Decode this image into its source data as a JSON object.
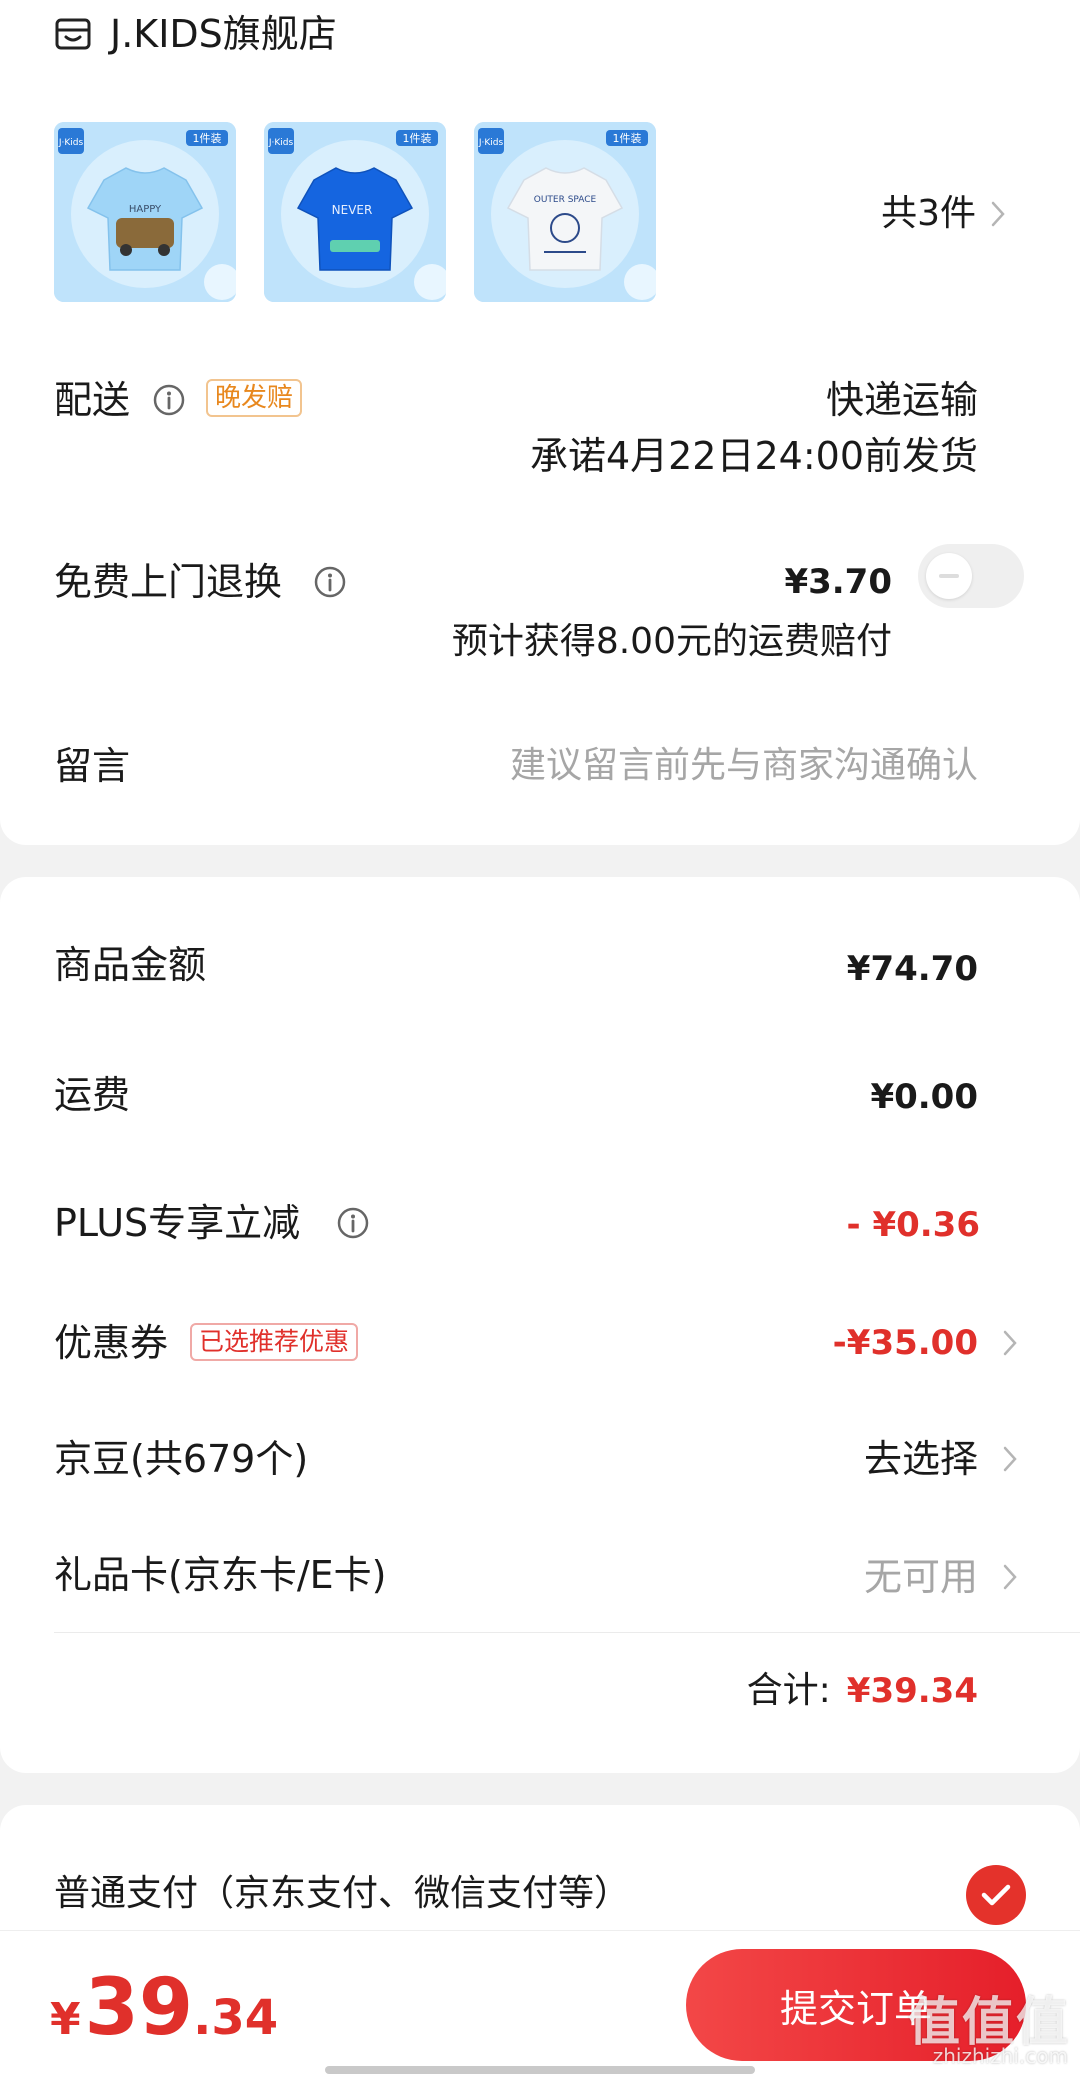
{
  "store": {
    "name": "J.KIDS旗舰店",
    "icon": "store-icon"
  },
  "products": {
    "thumbs": [
      {
        "badge": "1件装",
        "brand": "J·Kids",
        "shirt_color": "#9fd5f7",
        "print_text": "HAPPY"
      },
      {
        "badge": "1件装",
        "brand": "J·Kids",
        "shirt_color": "#1565e0",
        "print_text": "NEVER"
      },
      {
        "badge": "1件装",
        "brand": "J·Kids",
        "shirt_color": "#f4f6f8",
        "print_text": "OUTER SPACE"
      }
    ],
    "count_label": "共3件"
  },
  "delivery": {
    "label": "配送",
    "tag": "晚发赔",
    "method": "快递运输",
    "promise": "承诺4月22日24:00前发货"
  },
  "return_service": {
    "label": "免费上门退换",
    "price": "¥3.70",
    "note": "预计获得8.00元的运费赔付",
    "enabled": false
  },
  "message": {
    "label": "留言",
    "placeholder": "建议留言前先与商家沟通确认"
  },
  "summary": {
    "goods_amount_label": "商品金额",
    "goods_amount": "¥74.70",
    "shipping_label": "运费",
    "shipping": "¥0.00",
    "plus_label": "PLUS专享立减",
    "plus_value": "- ¥0.36",
    "coupon_label": "优惠券",
    "coupon_tag": "已选推荐优惠",
    "coupon_value": "-¥35.00",
    "jingdou_label": "京豆(共679个)",
    "jingdou_value": "去选择",
    "giftcard_label": "礼品卡(京东卡/E卡)",
    "giftcard_value": "无可用",
    "total_label": "合计:",
    "total_value": "¥39.34"
  },
  "payment": {
    "label": "普通支付（京东支付、微信支付等）",
    "selected": true
  },
  "bottom": {
    "currency": "¥",
    "total_int": "39",
    "total_dec": ".34",
    "submit_label": "提交订单"
  },
  "watermark": {
    "main": "值值值",
    "sub": "zhizhizhi.com"
  },
  "colors": {
    "accent": "#e0302b",
    "tag_orange": "#e8881e"
  }
}
